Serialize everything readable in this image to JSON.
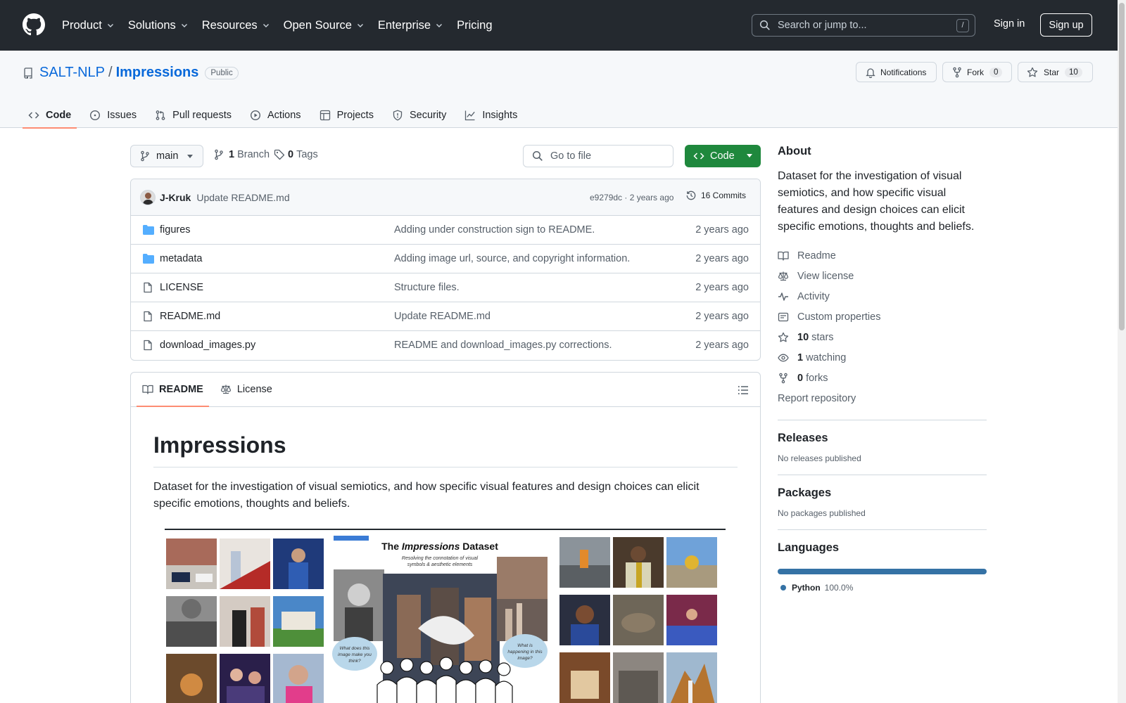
{
  "header": {
    "nav": [
      {
        "label": "Product"
      },
      {
        "label": "Solutions"
      },
      {
        "label": "Resources"
      },
      {
        "label": "Open Source"
      },
      {
        "label": "Enterprise"
      },
      {
        "label": "Pricing"
      }
    ],
    "search_placeholder": "Search or jump to...",
    "search_shortcut": "/",
    "sign_in": "Sign in",
    "sign_up": "Sign up"
  },
  "repo": {
    "owner": "SALT-NLP",
    "separator": "/",
    "name": "Impressions",
    "visibility": "Public",
    "notifications_label": "Notifications",
    "fork_label": "Fork",
    "fork_count": "0",
    "star_label": "Star",
    "star_count": "10"
  },
  "tabs": [
    {
      "label": "Code",
      "icon": "code-icon",
      "active": true
    },
    {
      "label": "Issues",
      "icon": "issue-icon"
    },
    {
      "label": "Pull requests",
      "icon": "pull-request-icon"
    },
    {
      "label": "Actions",
      "icon": "play-icon"
    },
    {
      "label": "Projects",
      "icon": "table-icon"
    },
    {
      "label": "Security",
      "icon": "shield-icon"
    },
    {
      "label": "Insights",
      "icon": "graph-icon"
    }
  ],
  "toolbar": {
    "branch": "main",
    "branch_count": "1",
    "branch_label": "Branch",
    "tag_count": "0",
    "tag_label": "Tags",
    "go_to_file": "Go to file",
    "code_button": "Code"
  },
  "commit": {
    "author": "J-Kruk",
    "message": "Update README.md",
    "hash_time": "e9279dc · 2 years ago",
    "commits": "16 Commits"
  },
  "files": [
    {
      "name": "figures",
      "type": "folder",
      "message": "Adding under construction sign to README.",
      "date": "2 years ago"
    },
    {
      "name": "metadata",
      "type": "folder",
      "message": "Adding image url, source, and copyright information.",
      "date": "2 years ago"
    },
    {
      "name": "LICENSE",
      "type": "file",
      "message": "Structure files.",
      "date": "2 years ago"
    },
    {
      "name": "README.md",
      "type": "file",
      "message": "Update README.md",
      "date": "2 years ago"
    },
    {
      "name": "download_images.py",
      "type": "file",
      "message": "README and download_images.py corrections.",
      "date": "2 years ago"
    }
  ],
  "readme": {
    "tab_readme": "README",
    "tab_license": "License",
    "title": "Impressions",
    "paragraph": "Dataset for the investigation of visual semiotics, and how specific visual features and design choices can elicit specific emotions, thoughts and beliefs.",
    "figure": {
      "title_pre": "The ",
      "title_em": "Impressions",
      "title_post": " Dataset",
      "subtitle_1": "Resolving the connotation of visual",
      "subtitle_2": "symbols & aesthetic elements",
      "bubble_left_1": "What does this",
      "bubble_left_2": "image make you",
      "bubble_left_3": "think?",
      "bubble_right_1": "What is",
      "bubble_right_2": "happening in this",
      "bubble_right_3": "image?"
    }
  },
  "about": {
    "heading": "About",
    "description": "Dataset for the investigation of visual semiotics, and how specific visual features and design choices can elicit specific emotions, thoughts and beliefs.",
    "links": [
      {
        "icon": "book-icon",
        "count": "",
        "label": "Readme"
      },
      {
        "icon": "law-icon",
        "count": "",
        "label": "View license"
      },
      {
        "icon": "pulse-icon",
        "count": "",
        "label": "Activity"
      },
      {
        "icon": "note-icon",
        "count": "",
        "label": "Custom properties"
      },
      {
        "icon": "star-icon",
        "count": "10",
        "label": "stars"
      },
      {
        "icon": "eye-icon",
        "count": "1",
        "label": "watching"
      },
      {
        "icon": "fork-icon",
        "count": "0",
        "label": "forks"
      }
    ],
    "report": "Report repository"
  },
  "releases": {
    "heading": "Releases",
    "text": "No releases published"
  },
  "packages": {
    "heading": "Packages",
    "text": "No packages published"
  },
  "languages": {
    "heading": "Languages",
    "items": [
      {
        "name": "Python",
        "percent": "100.0%",
        "color": "#3572A5"
      }
    ]
  },
  "colors": {
    "accent": "#0969da",
    "primary_button": "#1f883d",
    "header_bg": "#24292f",
    "tab_underline": "#fd8c73"
  }
}
